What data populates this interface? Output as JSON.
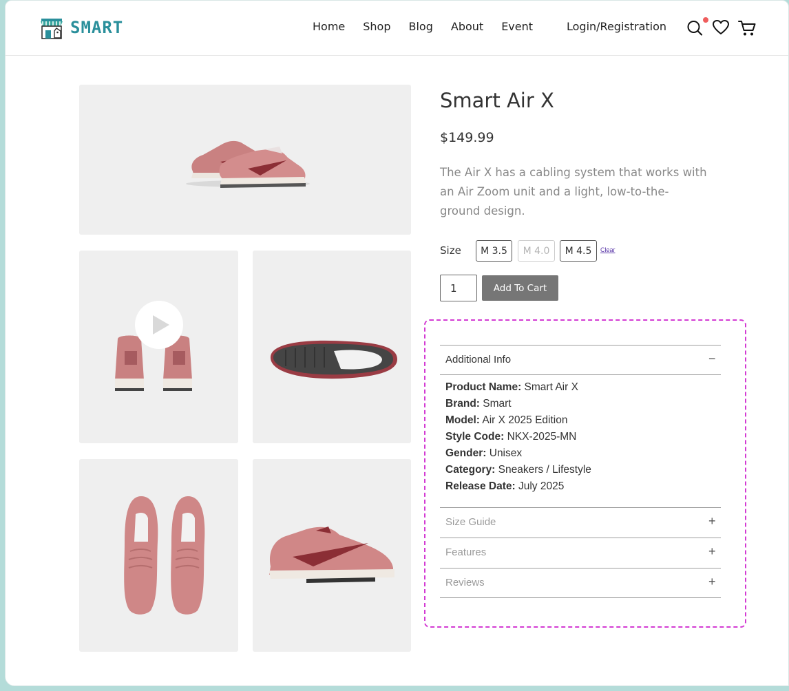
{
  "brand": {
    "name": "SMART"
  },
  "nav": {
    "items": [
      "Home",
      "Shop",
      "Blog",
      "About",
      "Event"
    ],
    "login": "Login/Registration"
  },
  "icons": {
    "search": "search-icon",
    "wishlist": "heart-icon",
    "cart": "cart-icon",
    "play": "play-icon"
  },
  "product": {
    "title": "Smart Air X",
    "price": "$149.99",
    "description": "The Air X has a cabling system that works with an Air Zoom unit and a light, low-to-the-ground design.",
    "size_label": "Size",
    "sizes": [
      "M 3.5",
      "M 4.0",
      "M 4.5"
    ],
    "clear": "Clear",
    "quantity": "1",
    "add_to_cart": "Add To Cart"
  },
  "accordion": {
    "additional_info": {
      "title": "Additional  Info",
      "rows": [
        {
          "label": "Product Name:",
          "value": " Smart Air X"
        },
        {
          "label": "Brand:",
          "value": " Smart"
        },
        {
          "label": "Model:",
          "value": " Air X 2025 Edition"
        },
        {
          "label": "Style Code:",
          "value": " NKX-2025-MN"
        },
        {
          "label": "Gender:",
          "value": " Unisex"
        },
        {
          "label": "Category:",
          "value": " Sneakers / Lifestyle"
        },
        {
          "label": "Release Date:",
          "value": " July 2025"
        }
      ]
    },
    "collapsed": [
      "Size Guide",
      "Features",
      "Reviews"
    ],
    "expanded_sign": "−",
    "collapsed_sign": "+"
  },
  "colors": {
    "brand": "#2a8f9b",
    "accent_dot": "#ef5d5d",
    "shoe": "#cf8787",
    "swoosh": "#8b2e35",
    "highlight_border": "#d33bd3"
  }
}
